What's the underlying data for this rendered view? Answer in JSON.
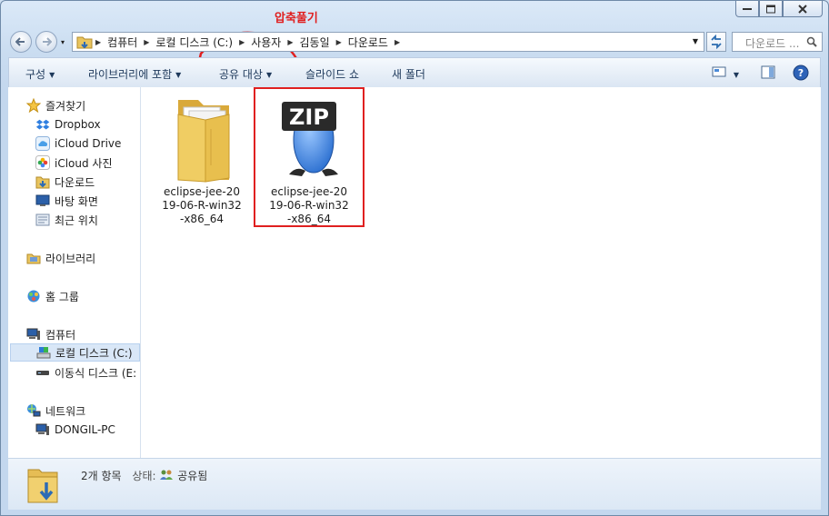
{
  "annotation": {
    "label": "압축풀기",
    "color": "#e02020"
  },
  "address": {
    "segments": [
      "컴퓨터",
      "로컬 디스크 (C:)",
      "사용자",
      "김동일",
      "다운로드"
    ],
    "search_placeholder": "다운로드 ..."
  },
  "commands": {
    "organize": "구성",
    "include_library": "라이브러리에 포함",
    "share": "공유 대상",
    "slideshow": "슬라이드 쇼",
    "new_folder": "새 폴더"
  },
  "sidebar": {
    "favorites": "즐겨찾기",
    "fav_items": [
      "Dropbox",
      "iCloud Drive",
      "iCloud 사진",
      "다운로드",
      "바탕 화면",
      "최근 위치"
    ],
    "libraries": "라이브러리",
    "homegroup": "홈 그룹",
    "computer": "컴퓨터",
    "computer_items": [
      "로컬 디스크 (C:)",
      "이동식 디스크 (E:"
    ],
    "network": "네트워크",
    "network_items": [
      "DONGIL-PC"
    ]
  },
  "files": [
    {
      "name": "eclipse-jee-2019-06-R-win32-x86_64",
      "type": "folder",
      "icon": "folder-icon"
    },
    {
      "name": "eclipse-jee-2019-06-R-win32-x86_64",
      "type": "zip",
      "icon": "zip-archive-icon",
      "badge": "ZIP"
    }
  ],
  "status": {
    "count": "2개 항목",
    "state_label": "상태:",
    "state_value": "공유됨"
  },
  "colors": {
    "accent": "#1e395b",
    "highlight": "#e02020",
    "selection": "#d9e7f7"
  }
}
